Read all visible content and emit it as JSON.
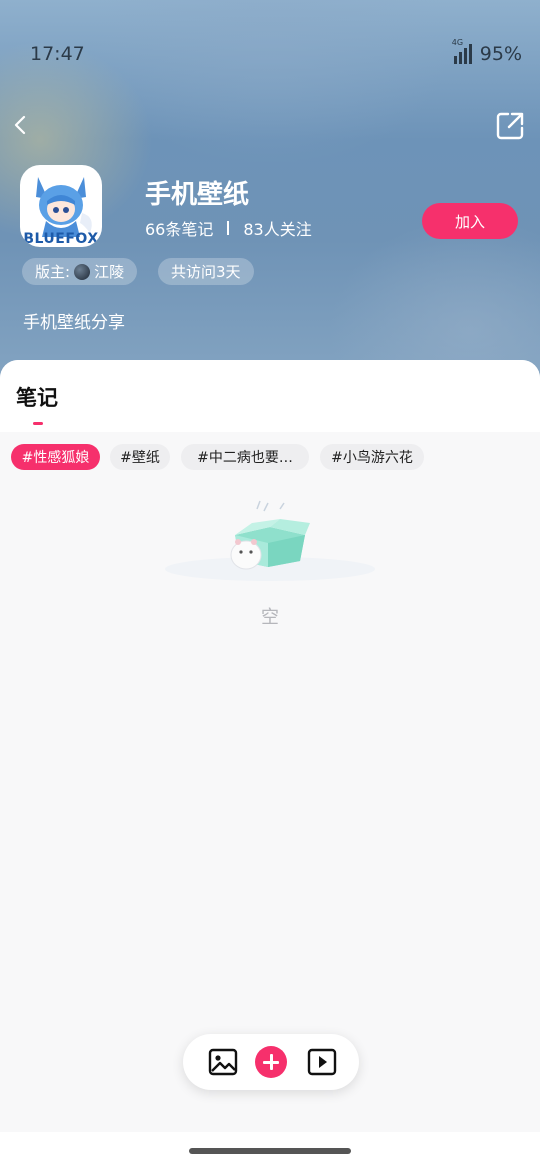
{
  "status_bar": {
    "time": "17:47",
    "network": "4G",
    "battery": "95%"
  },
  "header": {
    "group_name": "手机壁纸",
    "notes_count": "66条笔记",
    "followers": "83人关注",
    "join_label": "加入",
    "avatar_text": "BLUEFOX",
    "owner_prefix": "版主:",
    "owner_name": "江陵",
    "visit_text": "共访问3天",
    "description": "手机壁纸分享"
  },
  "tabs": {
    "notes": "笔记"
  },
  "tags": [
    "#性感狐娘",
    "#壁纸",
    "#中二病也要…",
    "#小鸟游六花"
  ],
  "empty": {
    "text": "空"
  },
  "colors": {
    "accent": "#f6306c",
    "chip_bg": "#eeeef0"
  },
  "icons": [
    "back-icon",
    "share-icon",
    "image-icon",
    "plus-icon",
    "video-icon"
  ]
}
